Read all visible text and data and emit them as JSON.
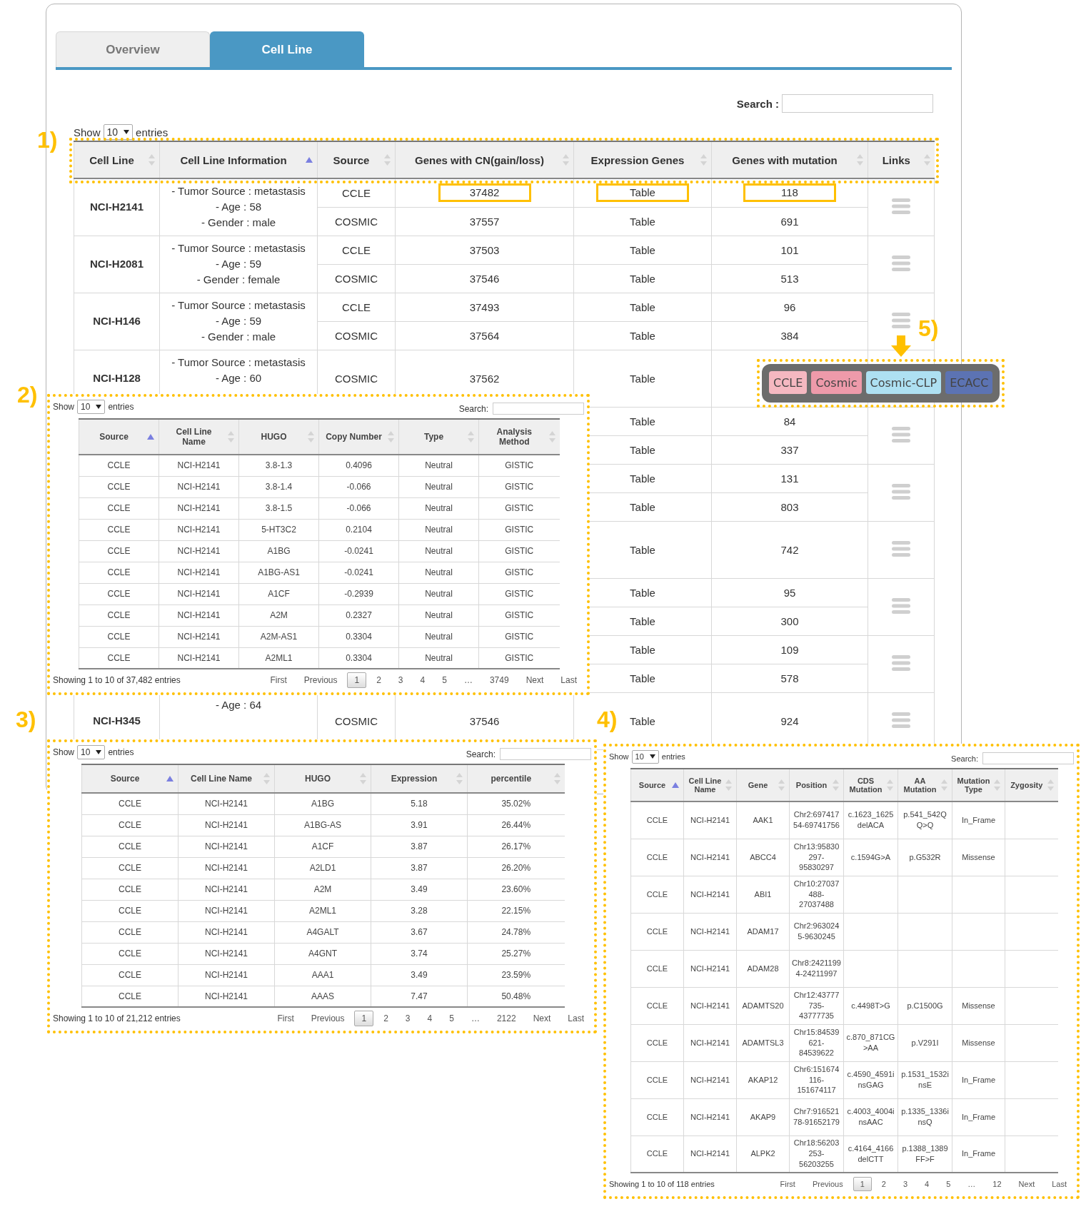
{
  "tabs": [
    {
      "label": "Overview",
      "selected": false
    },
    {
      "label": "Cell Line",
      "selected": true
    }
  ],
  "main_table": {
    "search_label": "Search :",
    "show_label": "Show",
    "page_size": "10",
    "entries_label": "entries",
    "columns": [
      {
        "label": "Cell Line",
        "sorted": false
      },
      {
        "label": "Cell Line Information",
        "sorted": true
      },
      {
        "label": "Source",
        "sorted": false
      },
      {
        "label": "Genes with CN(gain/loss)",
        "sorted": false
      },
      {
        "label": "Expression Genes",
        "sorted": false
      },
      {
        "label": "Genes with mutation",
        "sorted": false
      },
      {
        "label": "Links",
        "sorted": false
      }
    ],
    "rows": [
      {
        "cell_line": "NCI-H2141",
        "info": [
          "- Tumor Source : metastasis",
          "- Age : 58",
          "- Gender : male"
        ],
        "sources": [
          {
            "source": "CCLE",
            "cn": "37482",
            "expression": "Table",
            "mutation": "118",
            "highlighted": true
          },
          {
            "source": "COSMIC",
            "cn": "37557",
            "expression": "Table",
            "mutation": "691",
            "highlighted": false
          }
        ]
      },
      {
        "cell_line": "NCI-H2081",
        "info": [
          "- Tumor Source : metastasis",
          "- Age : 59",
          "- Gender : female"
        ],
        "sources": [
          {
            "source": "CCLE",
            "cn": "37503",
            "expression": "Table",
            "mutation": "101",
            "highlighted": false
          },
          {
            "source": "COSMIC",
            "cn": "37546",
            "expression": "Table",
            "mutation": "513",
            "highlighted": false
          }
        ]
      },
      {
        "cell_line": "NCI-H146",
        "info": [
          "- Tumor Source : metastasis",
          "- Age : 59",
          "- Gender : male"
        ],
        "sources": [
          {
            "source": "CCLE",
            "cn": "37493",
            "expression": "Table",
            "mutation": "96",
            "highlighted": false
          },
          {
            "source": "COSMIC",
            "cn": "37564",
            "expression": "Table",
            "mutation": "384",
            "highlighted": false
          }
        ]
      },
      {
        "cell_line": "NCI-H128",
        "info": [
          "- Tumor Source : metastasis",
          "- Age : 60"
        ],
        "sources": [
          {
            "source": "COSMIC",
            "cn": "37562",
            "expression": "Table",
            "highlighted": false
          }
        ]
      },
      {
        "sources": [
          {
            "expression": "Table",
            "mutation": "84",
            "highlighted": false
          },
          {
            "expression": "Table",
            "mutation": "337",
            "highlighted": false
          }
        ]
      },
      {
        "sources": [
          {
            "expression": "Table",
            "mutation": "131",
            "highlighted": false
          },
          {
            "expression": "Table",
            "mutation": "803",
            "highlighted": false
          }
        ]
      },
      {
        "sources": [
          {
            "expression": "Table",
            "mutation": "742",
            "highlighted": false
          }
        ]
      },
      {
        "sources": [
          {
            "expression": "Table",
            "mutation": "95",
            "highlighted": false
          },
          {
            "expression": "Table",
            "mutation": "300",
            "highlighted": false
          }
        ]
      },
      {
        "sources": [
          {
            "expression": "Table",
            "mutation": "109",
            "highlighted": false
          },
          {
            "expression": "Table",
            "mutation": "578",
            "highlighted": false
          }
        ]
      },
      {
        "cell_line": "NCI-H345",
        "info": [
          "- Age : 64"
        ],
        "sources": [
          {
            "source": "COSMIC",
            "cn": "37546",
            "expression": "Table",
            "mutation": "924",
            "highlighted": false
          }
        ]
      }
    ]
  },
  "annotations": [
    "1)",
    "2)",
    "3)",
    "4)",
    "5)"
  ],
  "cn_panel": {
    "show_label": "Show",
    "page_size": "10",
    "entries_label": "entries",
    "search_label": "Search:",
    "columns": [
      {
        "label": "Source",
        "sorted": true
      },
      {
        "label": "Cell Line Name",
        "sorted": false
      },
      {
        "label": "HUGO",
        "sorted": false
      },
      {
        "label": "Copy Number",
        "sorted": false
      },
      {
        "label": "Type",
        "sorted": false
      },
      {
        "label": "Analysis Method",
        "sorted": false
      }
    ],
    "rows": [
      [
        "CCLE",
        "NCI-H2141",
        "3.8-1.3",
        "0.4096",
        "Neutral",
        "GISTIC"
      ],
      [
        "CCLE",
        "NCI-H2141",
        "3.8-1.4",
        "-0.066",
        "Neutral",
        "GISTIC"
      ],
      [
        "CCLE",
        "NCI-H2141",
        "3.8-1.5",
        "-0.066",
        "Neutral",
        "GISTIC"
      ],
      [
        "CCLE",
        "NCI-H2141",
        "5-HT3C2",
        "0.2104",
        "Neutral",
        "GISTIC"
      ],
      [
        "CCLE",
        "NCI-H2141",
        "A1BG",
        "-0.0241",
        "Neutral",
        "GISTIC"
      ],
      [
        "CCLE",
        "NCI-H2141",
        "A1BG-AS1",
        "-0.0241",
        "Neutral",
        "GISTIC"
      ],
      [
        "CCLE",
        "NCI-H2141",
        "A1CF",
        "-0.2939",
        "Neutral",
        "GISTIC"
      ],
      [
        "CCLE",
        "NCI-H2141",
        "A2M",
        "0.2327",
        "Neutral",
        "GISTIC"
      ],
      [
        "CCLE",
        "NCI-H2141",
        "A2M-AS1",
        "0.3304",
        "Neutral",
        "GISTIC"
      ],
      [
        "CCLE",
        "NCI-H2141",
        "A2ML1",
        "0.3304",
        "Neutral",
        "GISTIC"
      ]
    ],
    "info": "Showing 1 to 10 of 37,482 entries",
    "pagination": [
      {
        "label": "First",
        "selected": false
      },
      {
        "label": "Previous",
        "selected": false
      },
      {
        "label": "1",
        "selected": true
      },
      {
        "label": "2",
        "selected": false
      },
      {
        "label": "3",
        "selected": false
      },
      {
        "label": "4",
        "selected": false
      },
      {
        "label": "5",
        "selected": false
      },
      {
        "label": "…",
        "selected": false
      },
      {
        "label": "3749",
        "selected": false
      },
      {
        "label": "Next",
        "selected": false
      },
      {
        "label": "Last",
        "selected": false
      }
    ]
  },
  "expression_panel": {
    "show_label": "Show",
    "page_size": "10",
    "entries_label": "entries",
    "search_label": "Search:",
    "columns": [
      {
        "label": "Source",
        "sorted": true
      },
      {
        "label": "Cell Line Name",
        "sorted": false
      },
      {
        "label": "HUGO",
        "sorted": false
      },
      {
        "label": "Expression",
        "sorted": false
      },
      {
        "label": "percentile",
        "sorted": false
      }
    ],
    "rows": [
      [
        "CCLE",
        "NCI-H2141",
        "A1BG",
        "5.18",
        "35.02%"
      ],
      [
        "CCLE",
        "NCI-H2141",
        "A1BG-AS",
        "3.91",
        "26.44%"
      ],
      [
        "CCLE",
        "NCI-H2141",
        "A1CF",
        "3.87",
        "26.17%"
      ],
      [
        "CCLE",
        "NCI-H2141",
        "A2LD1",
        "3.87",
        "26.20%"
      ],
      [
        "CCLE",
        "NCI-H2141",
        "A2M",
        "3.49",
        "23.60%"
      ],
      [
        "CCLE",
        "NCI-H2141",
        "A2ML1",
        "3.28",
        "22.15%"
      ],
      [
        "CCLE",
        "NCI-H2141",
        "A4GALT",
        "3.67",
        "24.78%"
      ],
      [
        "CCLE",
        "NCI-H2141",
        "A4GNT",
        "3.74",
        "25.27%"
      ],
      [
        "CCLE",
        "NCI-H2141",
        "AAA1",
        "3.49",
        "23.59%"
      ],
      [
        "CCLE",
        "NCI-H2141",
        "AAAS",
        "7.47",
        "50.48%"
      ]
    ],
    "info": "Showing 1 to 10 of 21,212 entries",
    "pagination": [
      {
        "label": "First",
        "selected": false
      },
      {
        "label": "Previous",
        "selected": false
      },
      {
        "label": "1",
        "selected": true
      },
      {
        "label": "2",
        "selected": false
      },
      {
        "label": "3",
        "selected": false
      },
      {
        "label": "4",
        "selected": false
      },
      {
        "label": "5",
        "selected": false
      },
      {
        "label": "…",
        "selected": false
      },
      {
        "label": "2122",
        "selected": false
      },
      {
        "label": "Next",
        "selected": false
      },
      {
        "label": "Last",
        "selected": false
      }
    ]
  },
  "mutation_panel": {
    "show_label": "Show",
    "page_size": "10",
    "entries_label": "entries",
    "search_label": "Search:",
    "columns": [
      {
        "label": "Source",
        "sorted": true
      },
      {
        "label": "Cell Line Name",
        "sorted": false
      },
      {
        "label": "Gene",
        "sorted": false
      },
      {
        "label": "Position",
        "sorted": false
      },
      {
        "label": "CDS Mutation",
        "sorted": false
      },
      {
        "label": "AA Mutation",
        "sorted": false
      },
      {
        "label": "Mutation Type",
        "sorted": false
      },
      {
        "label": "Zygosity",
        "sorted": false
      }
    ],
    "rows": [
      {
        "source": "CCLE",
        "cell_line": "NCI-H2141",
        "gene": "AAK1",
        "position": "Chr2:69741754-69741756",
        "cds_mutation": "c.1623_1625delACA",
        "aa_mutation": "p.541_542QQ>Q",
        "mutation_type": "In_Frame"
      },
      {
        "source": "CCLE",
        "cell_line": "NCI-H2141",
        "gene": "ABCC4",
        "position": "Chr13:95830297-95830297",
        "cds_mutation": "c.1594G>A",
        "aa_mutation": "p.G532R",
        "mutation_type": "Missense"
      },
      {
        "source": "CCLE",
        "cell_line": "NCI-H2141",
        "gene": "ABI1",
        "position": "Chr10:27037488-27037488"
      },
      {
        "source": "CCLE",
        "cell_line": "NCI-H2141",
        "gene": "ADAM17",
        "position": "Chr2:9630245-9630245"
      },
      {
        "source": "CCLE",
        "cell_line": "NCI-H2141",
        "gene": "ADAM28",
        "position": "Chr8:24211994-24211997"
      },
      {
        "source": "CCLE",
        "cell_line": "NCI-H2141",
        "gene": "ADAMTS20",
        "position": "Chr12:43777735-43777735",
        "cds_mutation": "c.4498T>G",
        "aa_mutation": "p.C1500G",
        "mutation_type": "Missense"
      },
      {
        "source": "CCLE",
        "cell_line": "NCI-H2141",
        "gene": "ADAMTSL3",
        "position": "Chr15:84539621-84539622",
        "cds_mutation": "c.870_871CG>AA",
        "aa_mutation": "p.V291I",
        "mutation_type": "Missense"
      },
      {
        "source": "CCLE",
        "cell_line": "NCI-H2141",
        "gene": "AKAP12",
        "position": "Chr6:151674116-151674117",
        "cds_mutation": "c.4590_4591insGAG",
        "aa_mutation": "p.1531_1532insE",
        "mutation_type": "In_Frame"
      },
      {
        "source": "CCLE",
        "cell_line": "NCI-H2141",
        "gene": "AKAP9",
        "position": "Chr7:91652178-91652179",
        "cds_mutation": "c.4003_4004insAAC",
        "aa_mutation": "p.1335_1336insQ",
        "mutation_type": "In_Frame"
      },
      {
        "source": "CCLE",
        "cell_line": "NCI-H2141",
        "gene": "ALPK2",
        "position": "Chr18:56203253-56203255",
        "cds_mutation": "c.4164_4166delCTT",
        "aa_mutation": "p.1388_1389FF>F",
        "mutation_type": "In_Frame"
      }
    ],
    "info": "Showing 1 to 10 of 118 entries",
    "pagination": [
      {
        "label": "First",
        "selected": false
      },
      {
        "label": "Previous",
        "selected": false
      },
      {
        "label": "1",
        "selected": true
      },
      {
        "label": "2",
        "selected": false
      },
      {
        "label": "3",
        "selected": false
      },
      {
        "label": "4",
        "selected": false
      },
      {
        "label": "5",
        "selected": false
      },
      {
        "label": "…",
        "selected": false
      },
      {
        "label": "12",
        "selected": false
      },
      {
        "label": "Next",
        "selected": false
      },
      {
        "label": "Last",
        "selected": false
      }
    ]
  },
  "links_popup": {
    "buttons": [
      {
        "label": "CCLE",
        "color": "#f5b8c1"
      },
      {
        "label": "Cosmic",
        "color": "#ee9aaa"
      },
      {
        "label": "Cosmic-CLP",
        "color": "#aee0f2"
      },
      {
        "label": "ECACC",
        "color": "#5c73b3"
      }
    ]
  }
}
